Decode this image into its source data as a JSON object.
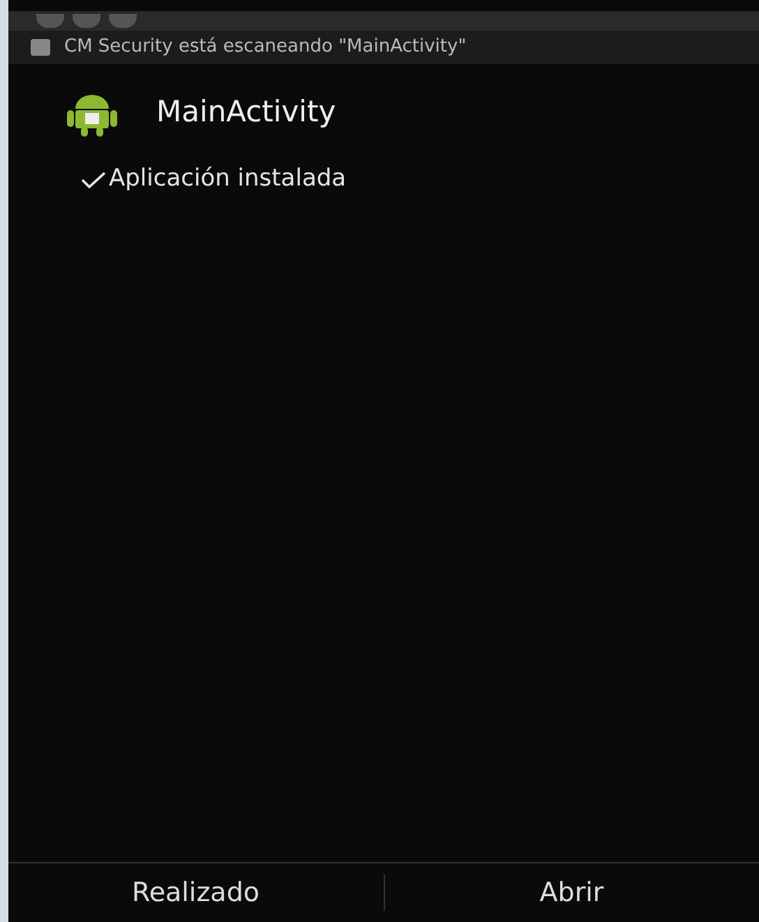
{
  "notification": {
    "text": "CM Security está escaneando \"MainActivity\""
  },
  "dialog": {
    "title": "MainActivity",
    "message": {
      "text": "Aplicación instalada",
      "checked": true
    }
  },
  "buttons": [
    {
      "label": "Realizado"
    },
    {
      "label": "Abrir"
    }
  ]
}
